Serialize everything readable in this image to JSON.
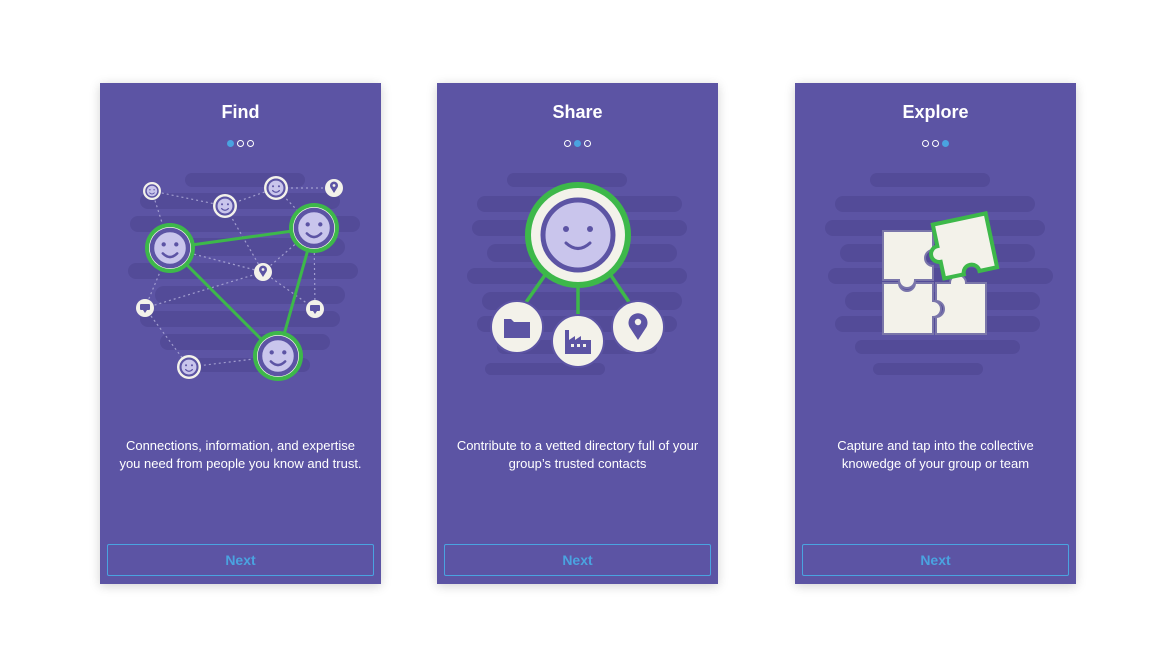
{
  "screens": [
    {
      "title": "Find",
      "description": "Connections, information, and expertise you need from people you know and trust.",
      "next_label": "Next",
      "active_dot": 0
    },
    {
      "title": "Share",
      "description": "Contribute to a vetted directory full of your group’s trusted contacts",
      "next_label": "Next",
      "active_dot": 1
    },
    {
      "title": "Explore",
      "description": "Capture and tap into the collective knowedge of your group or team",
      "next_label": "Next",
      "active_dot": 2
    }
  ],
  "colors": {
    "background": "#5c54a4",
    "accent_blue": "#4aa3e0",
    "connection_green": "#3db84a",
    "face_fill": "#c9c5ec",
    "cream": "#f3f2ea"
  },
  "icons": [
    "smiley-face-icon",
    "location-pin-icon",
    "chat-bubble-icon",
    "folder-icon",
    "factory-icon",
    "puzzle-icon"
  ]
}
